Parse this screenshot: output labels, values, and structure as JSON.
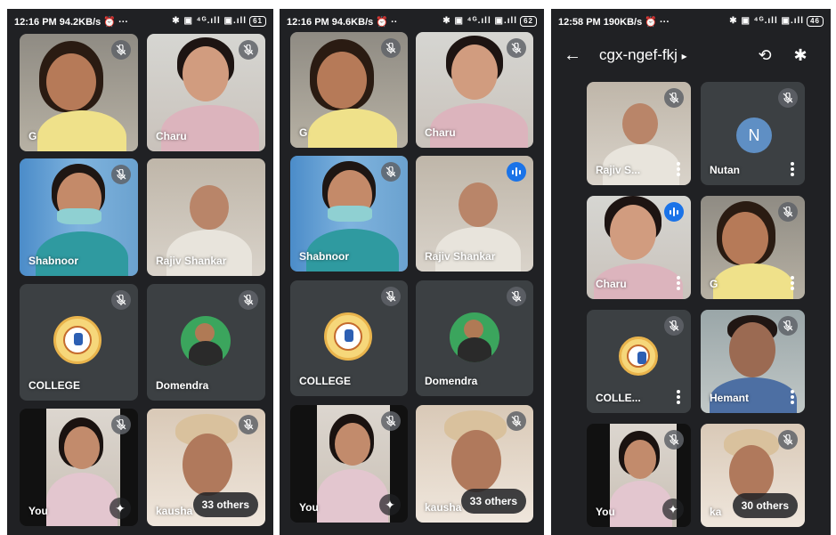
{
  "panels": [
    {
      "status": {
        "time": "12:16 PM",
        "speed": "94.2KB/s",
        "icons_left": "⏰ ···",
        "icons_right": "✱ ▣ ⁴ᴳ.ıll ▣.ıll",
        "battery": "61"
      },
      "tiles": [
        {
          "name": "G",
          "mic": "muted"
        },
        {
          "name": "Charu",
          "mic": "muted"
        },
        {
          "name": "Shabnoor",
          "mic": "muted"
        },
        {
          "name": "Rajiv Shankar",
          "mic": "none"
        },
        {
          "name": "COLLEGE",
          "mic": "muted"
        },
        {
          "name": "Domendra",
          "mic": "muted"
        },
        {
          "name": "You",
          "mic": "muted"
        },
        {
          "name": "kausha",
          "mic": "muted",
          "others": "33 others"
        }
      ]
    },
    {
      "status": {
        "time": "12:16 PM",
        "speed": "94.6KB/s",
        "icons_left": "⏰ ··",
        "icons_right": "✱ ▣ ⁴ᴳ.ıll ▣.ıll",
        "battery": "62"
      },
      "tiles": [
        {
          "name": "G",
          "mic": "muted"
        },
        {
          "name": "Charu",
          "mic": "muted"
        },
        {
          "name": "Shabnoor",
          "mic": "muted"
        },
        {
          "name": "Rajiv Shankar",
          "mic": "speaking"
        },
        {
          "name": "COLLEGE",
          "mic": "muted"
        },
        {
          "name": "Domendra",
          "mic": "muted"
        },
        {
          "name": "You",
          "mic": "muted"
        },
        {
          "name": "kausha",
          "mic": "muted",
          "others": "33 others"
        }
      ]
    },
    {
      "status": {
        "time": "12:58 PM",
        "speed": "190KB/s",
        "icons_left": "⏰ ···",
        "icons_right": "✱ ▣ ⁴ᴳ.ıll ▣.ıll",
        "battery": "46"
      },
      "meeting_code": "cgx-ngef-fkj",
      "tiles": [
        {
          "name": "Rajiv S...",
          "mic": "muted"
        },
        {
          "name": "Nutan",
          "mic": "muted",
          "initial": "N"
        },
        {
          "name": "Charu",
          "mic": "speaking"
        },
        {
          "name": "G",
          "mic": "muted"
        },
        {
          "name": "COLLE...",
          "mic": "muted"
        },
        {
          "name": "Hemant",
          "mic": "muted"
        },
        {
          "name": "You",
          "mic": "muted"
        },
        {
          "name": "ka",
          "mic": "muted",
          "others": "30 others"
        }
      ]
    }
  ],
  "colors": {
    "background": "#202124",
    "tile": "#3c4043",
    "speaking": "#1a73e8"
  },
  "icons": {
    "back": "←",
    "chevron": "▸",
    "camera_switch": "⟲",
    "bluetooth": "✱",
    "sparkle": "✦"
  }
}
